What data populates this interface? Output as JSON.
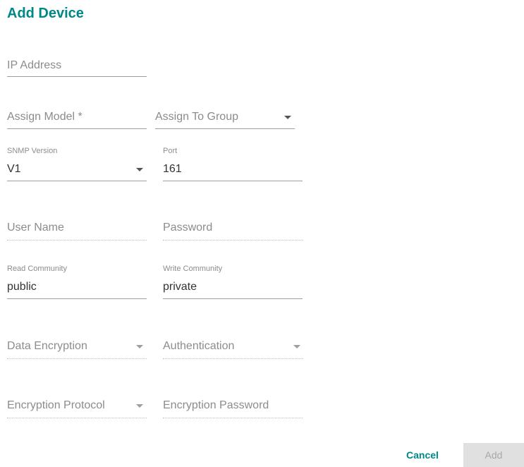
{
  "dialog": {
    "title": "Add Device"
  },
  "form": {
    "ip_address": {
      "placeholder": "IP Address"
    },
    "assign_model": {
      "placeholder": "Assign Model *"
    },
    "assign_group": {
      "placeholder": "Assign To Group"
    },
    "snmp_version": {
      "label": "SNMP Version",
      "value": "V1"
    },
    "port": {
      "label": "Port",
      "value": "161"
    },
    "user_name": {
      "placeholder": "User Name"
    },
    "password": {
      "placeholder": "Password"
    },
    "read_community": {
      "label": "Read Community",
      "value": "public"
    },
    "write_community": {
      "label": "Write Community",
      "value": "private"
    },
    "data_encryption": {
      "placeholder": "Data Encryption"
    },
    "authentication": {
      "placeholder": "Authentication"
    },
    "encryption_protocol": {
      "placeholder": "Encryption Protocol"
    },
    "encryption_password": {
      "placeholder": "Encryption Password"
    }
  },
  "actions": {
    "cancel_label": "Cancel",
    "add_label": "Add"
  },
  "colors": {
    "accent": "#008787",
    "disabled_bg": "#e0e0e0"
  }
}
